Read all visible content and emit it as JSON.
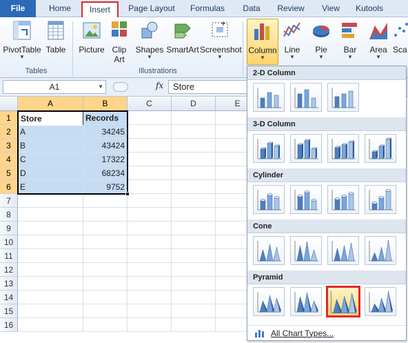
{
  "ribbon": {
    "tabs": [
      "File",
      "Home",
      "Insert",
      "Page Layout",
      "Formulas",
      "Data",
      "Review",
      "View",
      "Kutools"
    ],
    "active_tab": "Insert",
    "buttons": {
      "pivottable": "PivotTable",
      "table": "Table",
      "picture": "Picture",
      "clip_art_1": "Clip",
      "clip_art_2": "Art",
      "shapes": "Shapes",
      "smartart": "SmartArt",
      "screenshot": "Screenshot",
      "column": "Column",
      "line": "Line",
      "pie": "Pie",
      "bar": "Bar",
      "area": "Area",
      "scatter": "Sca"
    },
    "groups": {
      "tables": "Tables",
      "illustrations": "Illustrations"
    }
  },
  "formula_bar": {
    "name_box": "A1",
    "fx": "fx",
    "value": "Store"
  },
  "sheet": {
    "columns": [
      "A",
      "B",
      "C",
      "D",
      "E"
    ],
    "rows": [
      "1",
      "2",
      "3",
      "4",
      "5",
      "6",
      "7",
      "8",
      "9",
      "10",
      "11",
      "12",
      "13",
      "14",
      "15",
      "16"
    ],
    "header": [
      "Store",
      "Records"
    ],
    "data": [
      {
        "store": "A",
        "records": "34245"
      },
      {
        "store": "B",
        "records": "43424"
      },
      {
        "store": "C",
        "records": "17322"
      },
      {
        "store": "D",
        "records": "68234"
      },
      {
        "store": "E",
        "records": "9752"
      }
    ]
  },
  "gallery": {
    "sections": [
      "2-D Column",
      "3-D Column",
      "Cylinder",
      "Cone",
      "Pyramid"
    ],
    "selected": "Pyramid item 3",
    "all_chart_types": "All Chart Types..."
  },
  "colors": {
    "file_tab": "#2a6ab6",
    "highlight": "#e0262b",
    "selection_fill": "#c6dcf3"
  }
}
